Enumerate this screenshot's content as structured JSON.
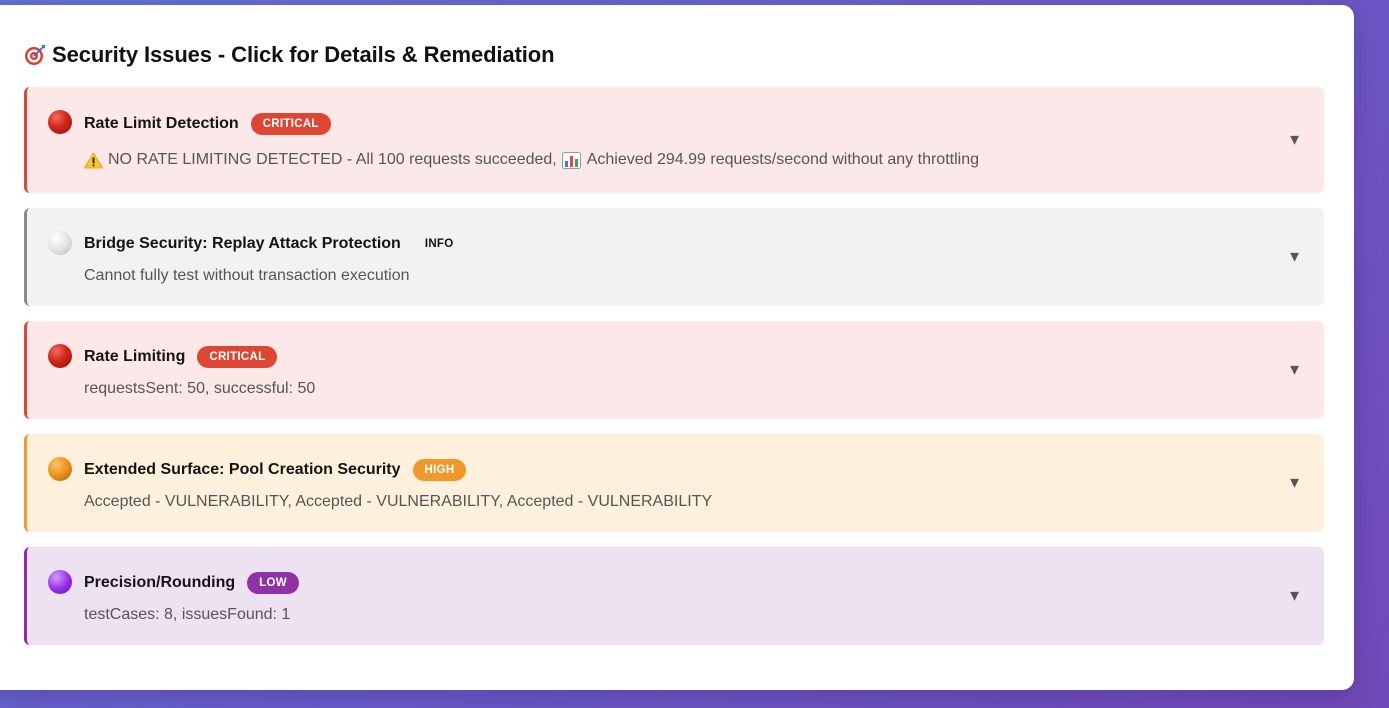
{
  "header": {
    "icon": "target-dart-icon",
    "title": "Security Issues - Click for Details & Remediation"
  },
  "colors": {
    "critical": "#dc4632",
    "info": "#8a8a8a",
    "high": "#f0982b",
    "low": "#8f32a6"
  },
  "issues": [
    {
      "title": "Rate Limit Detection",
      "severity": "CRITICAL",
      "description_part1": "NO RATE LIMITING DETECTED - All 100 requests succeeded,",
      "description_part2": "Achieved 294.99 requests/second without any throttling"
    },
    {
      "title": "Bridge Security: Replay Attack Protection",
      "severity": "INFO",
      "description": "Cannot fully test without transaction execution"
    },
    {
      "title": "Rate Limiting",
      "severity": "CRITICAL",
      "description": "requestsSent: 50, successful: 50"
    },
    {
      "title": "Extended Surface: Pool Creation Security",
      "severity": "HIGH",
      "description": "Accepted - VULNERABILITY, Accepted - VULNERABILITY, Accepted - VULNERABILITY"
    },
    {
      "title": "Precision/Rounding",
      "severity": "LOW",
      "description": "testCases: 8, issuesFound: 1"
    }
  ],
  "expand_glyph": "▼"
}
